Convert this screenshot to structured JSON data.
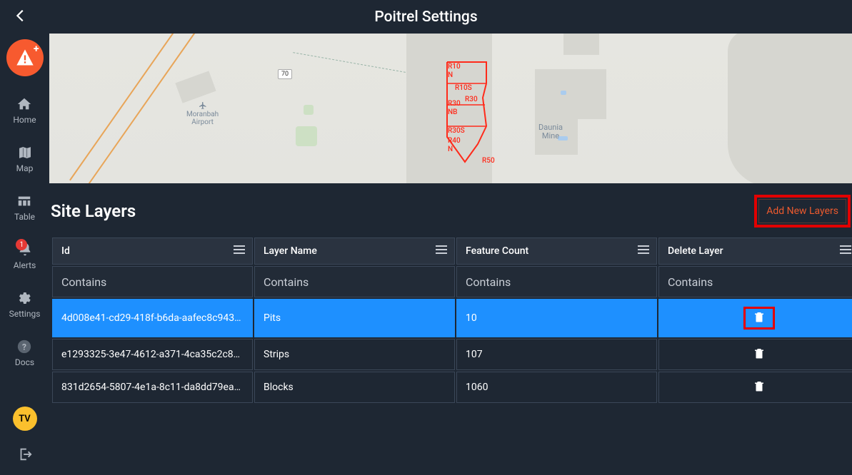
{
  "header": {
    "title": "Poitrel Settings"
  },
  "sidebar": {
    "items": [
      {
        "key": "home",
        "label": "Home"
      },
      {
        "key": "map",
        "label": "Map"
      },
      {
        "key": "table",
        "label": "Table"
      },
      {
        "key": "alerts",
        "label": "Alerts",
        "badge": "1"
      },
      {
        "key": "settings",
        "label": "Settings"
      },
      {
        "key": "docs",
        "label": "Docs"
      }
    ],
    "avatar": "TV"
  },
  "map": {
    "route_badge": "70",
    "airport_label": "Moranbah\nAirport",
    "mine_label": "Daunia\nMine",
    "r_labels": [
      "R10",
      "N",
      "R10S",
      "R30",
      "R30",
      "NB",
      "R30S",
      "R40",
      "N",
      "R50"
    ]
  },
  "section": {
    "title": "Site Layers",
    "add_button": "Add New Layers"
  },
  "table": {
    "columns": [
      "Id",
      "Layer Name",
      "Feature Count",
      "Delete Layer"
    ],
    "filter_placeholder": "Contains",
    "rows": [
      {
        "id": "4d008e41-cd29-418f-b6da-aafec8c943…",
        "name": "Pits",
        "count": "10",
        "selected": true,
        "highlight_delete": true
      },
      {
        "id": "e1293325-3e47-4612-a371-4ca35c2c8…",
        "name": "Strips",
        "count": "107",
        "selected": false,
        "highlight_delete": false
      },
      {
        "id": "831d2654-5807-4e1a-8c11-da8dd79ea…",
        "name": "Blocks",
        "count": "1060",
        "selected": false,
        "highlight_delete": false
      }
    ]
  }
}
